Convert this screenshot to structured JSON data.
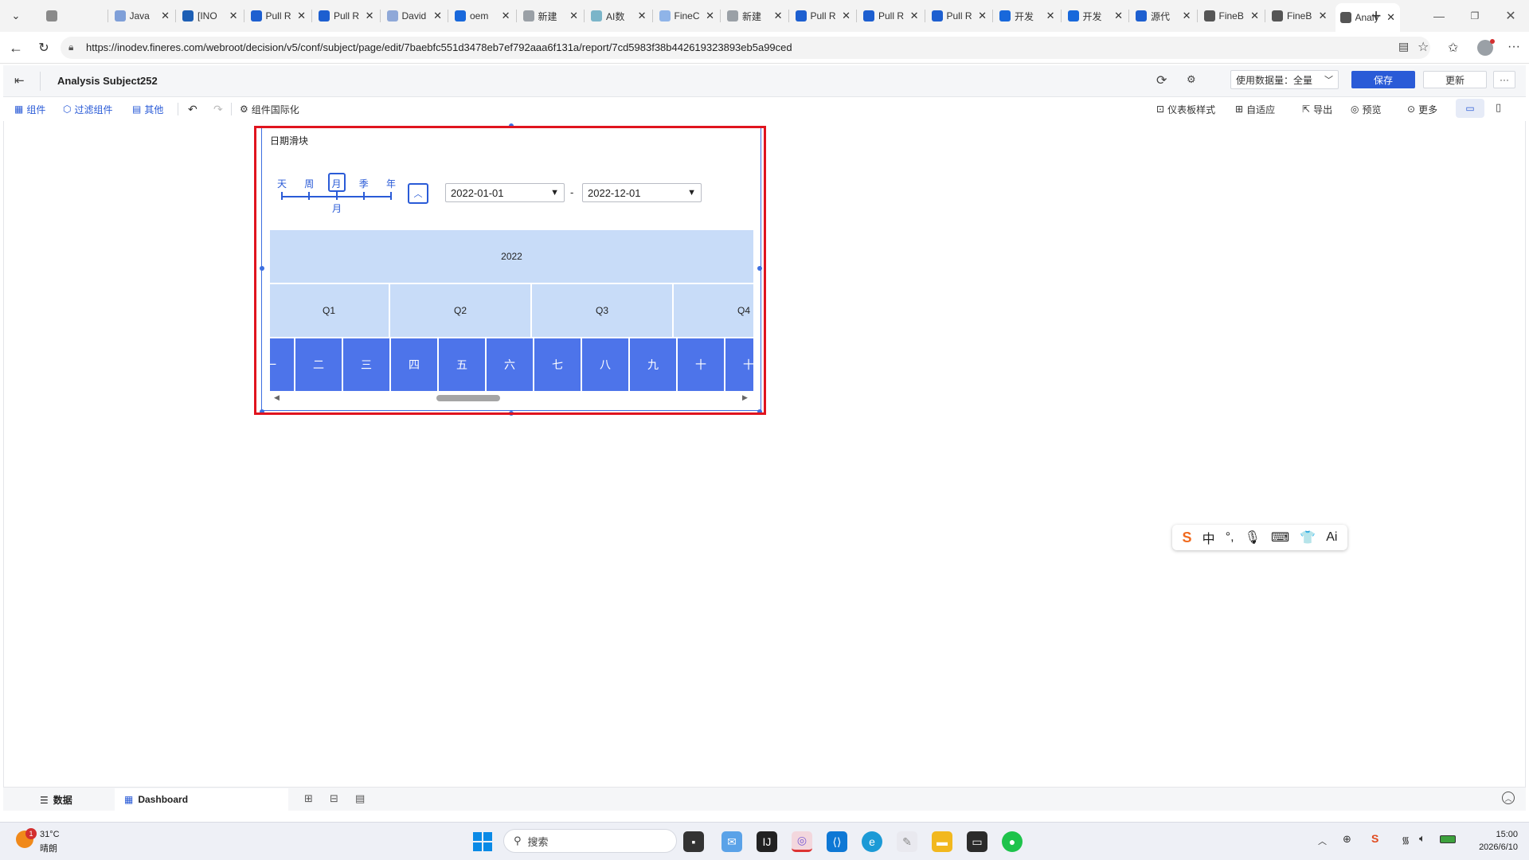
{
  "browser": {
    "tabs": [
      {
        "title": "",
        "icon": "tab-groups-icon",
        "color": "#8a8a8a"
      },
      {
        "title": "Java",
        "icon": "doc-icon",
        "color": "#7f9fd8"
      },
      {
        "title": "[INO",
        "icon": "jira-icon",
        "color": "#1d5fb5"
      },
      {
        "title": "Pull R",
        "icon": "bitbucket-icon",
        "color": "#1d5fd0"
      },
      {
        "title": "Pull R",
        "icon": "bitbucket-icon",
        "color": "#1d5fd0"
      },
      {
        "title": "David",
        "icon": "bitbucket-icon",
        "color": "#8fa8d8"
      },
      {
        "title": "oem",
        "icon": "confluence-icon",
        "color": "#1868db"
      },
      {
        "title": "新建",
        "icon": "page-icon",
        "color": "#9aa0a6"
      },
      {
        "title": "AI数",
        "icon": "image-icon",
        "color": "#7bb5c9"
      },
      {
        "title": "FineC",
        "icon": "doc-icon",
        "color": "#8fb4e8"
      },
      {
        "title": "新建",
        "icon": "page-icon",
        "color": "#9aa0a6"
      },
      {
        "title": "Pull R",
        "icon": "bitbucket-icon",
        "color": "#1d5fd0"
      },
      {
        "title": "Pull R",
        "icon": "bitbucket-icon",
        "color": "#1d5fd0"
      },
      {
        "title": "Pull R",
        "icon": "bitbucket-icon",
        "color": "#1d5fd0"
      },
      {
        "title": "开发",
        "icon": "confluence-icon",
        "color": "#1868db"
      },
      {
        "title": "开发",
        "icon": "confluence-icon",
        "color": "#1868db"
      },
      {
        "title": "源代",
        "icon": "bitbucket-icon",
        "color": "#1d5fd0"
      },
      {
        "title": "FineB",
        "icon": "globe-icon",
        "color": "#555555"
      },
      {
        "title": "FineB",
        "icon": "globe-icon",
        "color": "#555555"
      },
      {
        "title": "Analy",
        "icon": "globe-icon",
        "color": "#555555"
      }
    ],
    "url": "https://inodev.fineres.com/webroot/decision/v5/conf/subject/page/edit/7baebfc551d3478eb7ef792aaa6f131a/report/7cd5983f38b442619323893eb5a99ced"
  },
  "app": {
    "title": "Analysis Subject252",
    "data_scope_label": "使用数据量：全量",
    "save_label": "保存",
    "update_label": "更新",
    "more_label": "···",
    "accent": "#2a5bd7"
  },
  "toolbar": {
    "component": "组件",
    "filter_component": "过滤组件",
    "other": "其他",
    "i18n": "组件国际化",
    "dashboard_style": "仪表板样式",
    "adaptive": "自适应",
    "export": "导出",
    "preview": "预览",
    "more": "更多"
  },
  "widget": {
    "title": "日期滑块",
    "granularity": [
      "天",
      "周",
      "月",
      "季",
      "年"
    ],
    "selected_granularity": "月",
    "start_date": "2022-01-01",
    "separator": "-",
    "end_date": "2022-12-01",
    "year": "2022",
    "quarters": [
      "Q1",
      "Q2",
      "Q3",
      "Q4"
    ],
    "months": [
      "一",
      "二",
      "三",
      "四",
      "五",
      "六",
      "七",
      "八",
      "九",
      "十",
      "十"
    ],
    "selection_color": "#e0141e"
  },
  "bottom": {
    "data_tab": "数据",
    "dashboard_tab": "Dashboard"
  },
  "ime": {
    "items": [
      "中",
      "°,",
      "🎙",
      "⌨",
      "👕",
      "Ai"
    ]
  },
  "taskbar": {
    "weather_temp": "31°C",
    "weather_desc": "晴朗",
    "weather_badge": "1",
    "search_placeholder": "搜索",
    "time": "15:00",
    "date": "2026/6/10"
  }
}
